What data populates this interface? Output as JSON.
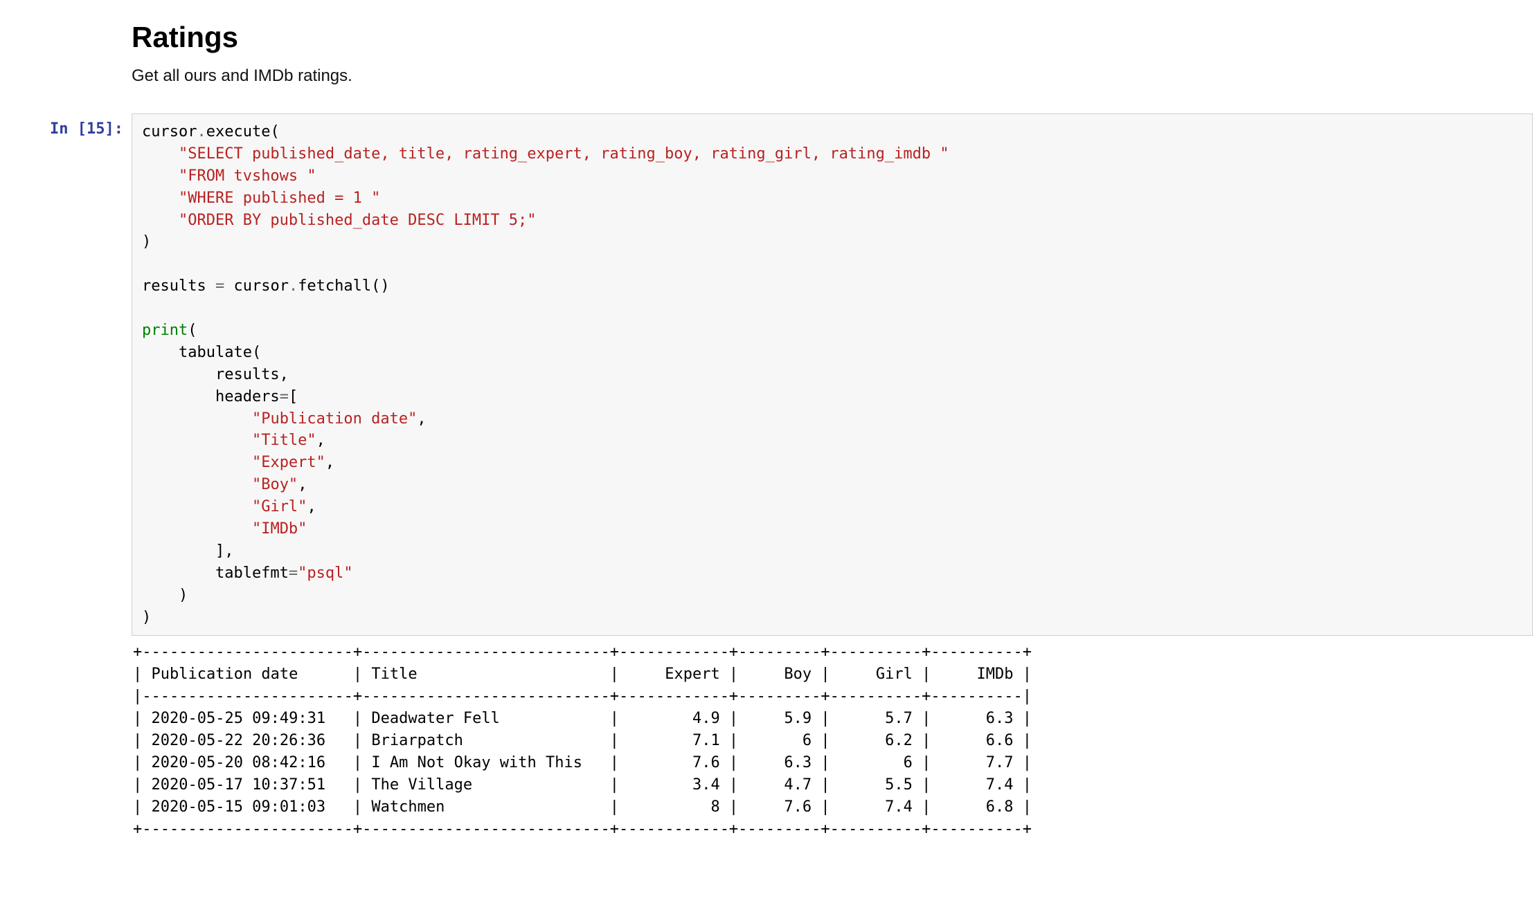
{
  "section": {
    "title": "Ratings",
    "description": "Get all ours and IMDb ratings."
  },
  "cell": {
    "prompt": "In [15]:",
    "code": {
      "l1a": "cursor",
      "l1b": ".",
      "l1c": "execute(",
      "l2": "\"SELECT published_date, title, rating_expert, rating_boy, rating_girl, rating_imdb \"",
      "l3": "\"FROM tvshows \"",
      "l4": "\"WHERE published = 1 \"",
      "l5": "\"ORDER BY published_date DESC LIMIT 5;\"",
      "l6": ")",
      "l7": "",
      "l8a": "results ",
      "l8b": "=",
      "l8c": " cursor",
      "l8d": ".",
      "l8e": "fetchall()",
      "l9": "",
      "l10a": "print",
      "l10b": "(",
      "l11": "    tabulate(",
      "l12": "        results,",
      "l13a": "        headers",
      "l13b": "=",
      "l13c": "[",
      "l14": "\"Publication date\"",
      "l14x": ",",
      "l15": "\"Title\"",
      "l15x": ",",
      "l16": "\"Expert\"",
      "l16x": ",",
      "l17": "\"Boy\"",
      "l17x": ",",
      "l18": "\"Girl\"",
      "l18x": ",",
      "l19": "\"IMDb\"",
      "l20": "        ],",
      "l21a": "        tablefmt",
      "l21b": "=",
      "l21c": "\"psql\"",
      "l22": "    )",
      "l23": ")"
    },
    "table": {
      "headers": [
        "Publication date",
        "Title",
        "Expert",
        "Boy",
        "Girl",
        "IMDb"
      ],
      "rows": [
        {
          "date": "2020-05-25 09:49:31",
          "title": "Deadwater Fell",
          "expert": "4.9",
          "boy": "5.9",
          "girl": "5.7",
          "imdb": "6.3"
        },
        {
          "date": "2020-05-22 20:26:36",
          "title": "Briarpatch",
          "expert": "7.1",
          "boy": "6",
          "girl": "6.2",
          "imdb": "6.6"
        },
        {
          "date": "2020-05-20 08:42:16",
          "title": "I Am Not Okay with This",
          "expert": "7.6",
          "boy": "6.3",
          "girl": "6",
          "imdb": "7.7"
        },
        {
          "date": "2020-05-17 10:37:51",
          "title": "The Village",
          "expert": "3.4",
          "boy": "4.7",
          "girl": "5.5",
          "imdb": "7.4"
        },
        {
          "date": "2020-05-15 09:01:03",
          "title": "Watchmen",
          "expert": "8",
          "boy": "7.6",
          "girl": "7.4",
          "imdb": "6.8"
        }
      ]
    }
  }
}
